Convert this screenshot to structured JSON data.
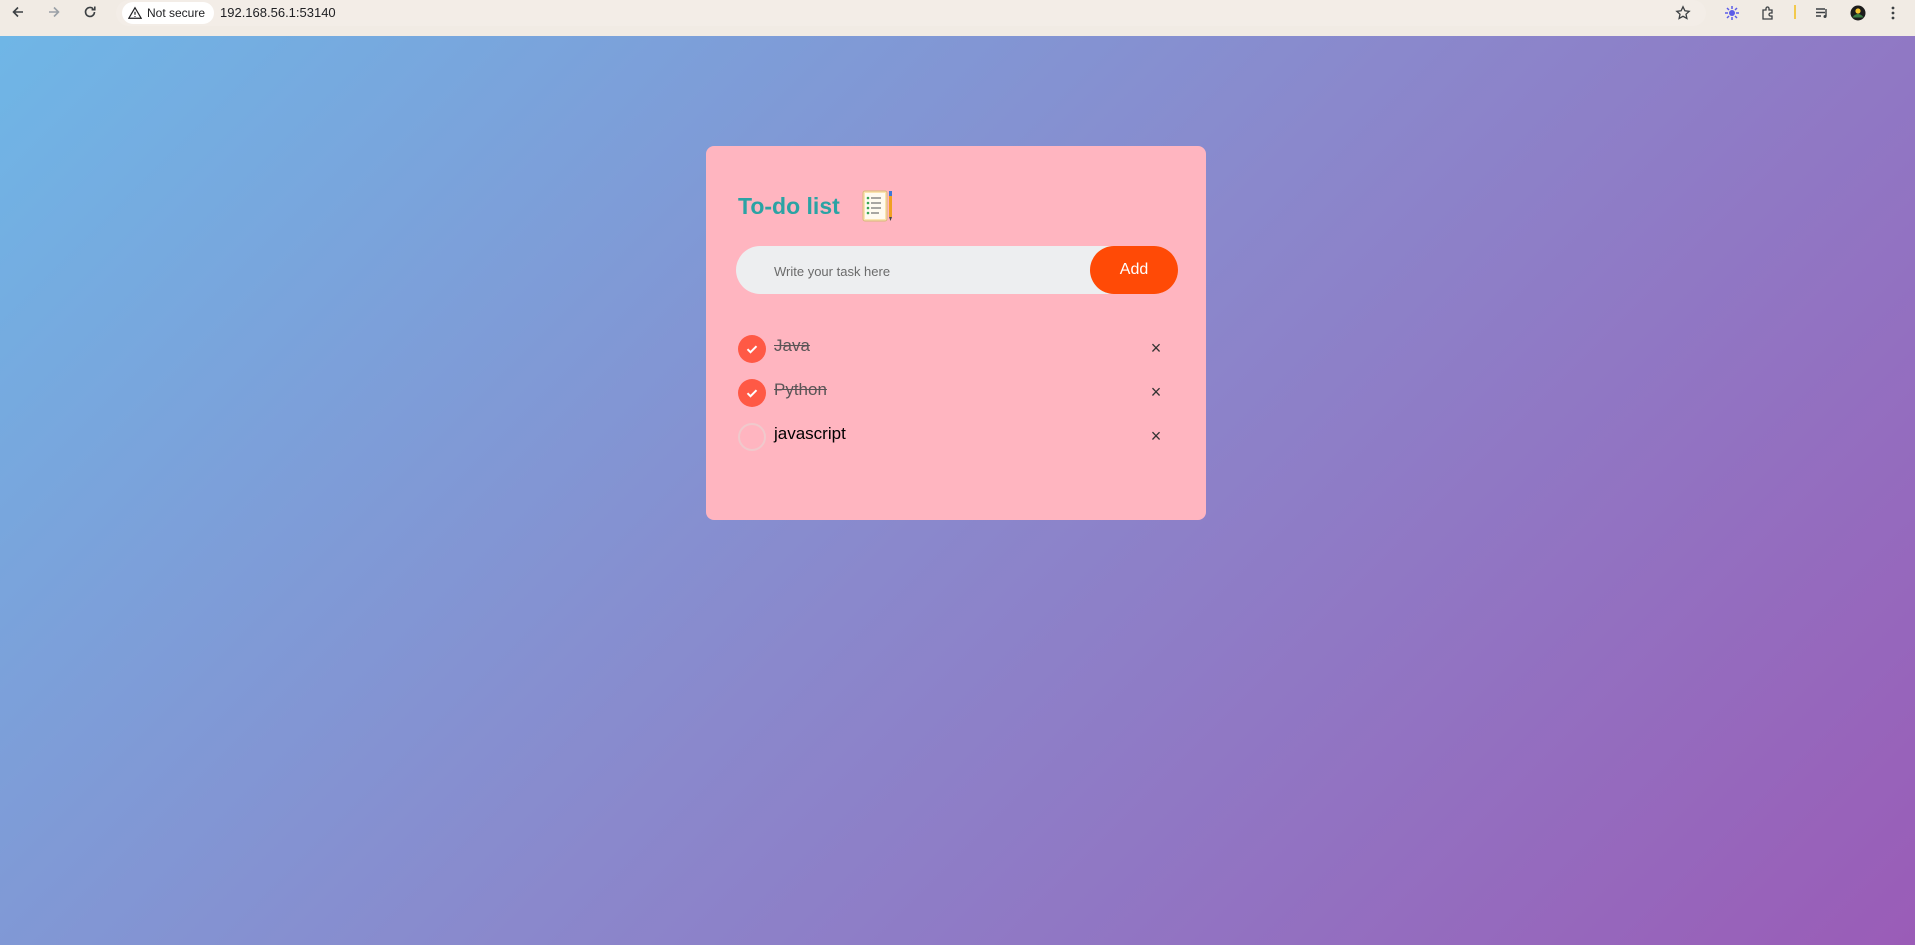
{
  "browser": {
    "security_label": "Not secure",
    "url": "192.168.56.1:53140",
    "icons": [
      "back-arrow-icon",
      "forward-arrow-icon",
      "reload-icon",
      "warning-icon",
      "star-icon",
      "extension-icon",
      "puzzle-icon",
      "media-icon",
      "profile-avatar-icon",
      "menu-kebab-icon"
    ]
  },
  "app": {
    "title": "To-do list",
    "title_icon": "checklist-notebook-icon",
    "input_placeholder": "Write your task here",
    "add_label": "Add",
    "tasks": [
      {
        "text": "Java",
        "completed": true
      },
      {
        "text": "Python",
        "completed": true
      },
      {
        "text": "javascript",
        "completed": false
      }
    ],
    "delete_glyph": "×"
  },
  "colors": {
    "card": "#ffb5c0",
    "title": "#2ba3a4",
    "add_button": "#ff4a06",
    "check_done": "#ff5945",
    "gradient_start": "#6fb6e6",
    "gradient_end": "#9a5cb7"
  }
}
